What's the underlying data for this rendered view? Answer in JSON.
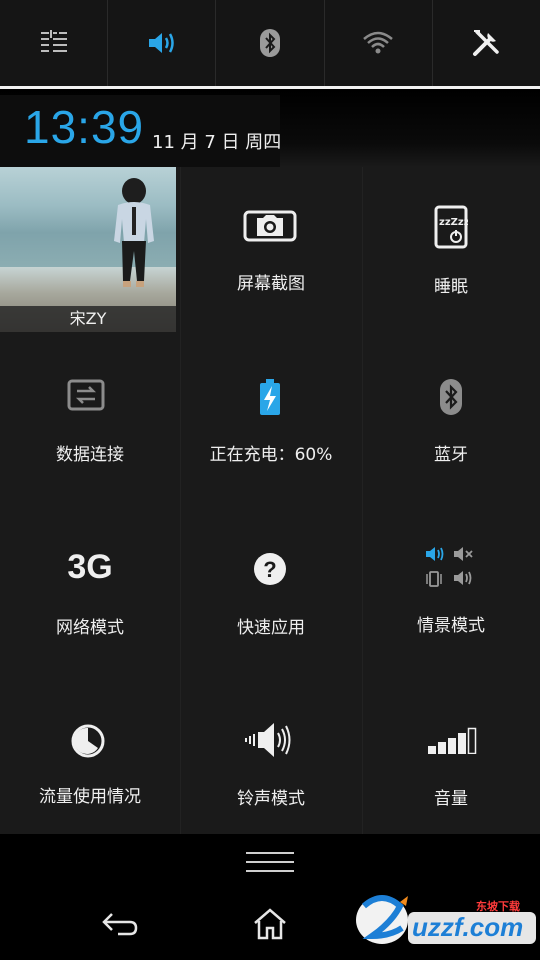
{
  "toggles": [
    {
      "name": "settings-list-icon",
      "active": false
    },
    {
      "name": "sound-icon",
      "active": true
    },
    {
      "name": "bluetooth-icon",
      "active": false
    },
    {
      "name": "wifi-icon",
      "active": false
    },
    {
      "name": "tools-icon",
      "active": false
    }
  ],
  "clock": {
    "time": "13:39",
    "date": "11 月 7 日 周四"
  },
  "profile": {
    "name": "宋ZY"
  },
  "tiles": {
    "screenshot": "屏幕截图",
    "sleep": "睡眠",
    "data": "数据连接",
    "charging": "正在充电：60%",
    "bluetooth": "蓝牙",
    "network": "网络模式",
    "network_icon_text": "3G",
    "quick_apps": "快速应用",
    "scene": "情景模式",
    "traffic": "流量使用情况",
    "ringtone": "铃声模式",
    "volume": "音量"
  },
  "watermark": {
    "text": "uzzf.com",
    "sub": "东坡下载"
  },
  "colors": {
    "accent": "#2aa6e8",
    "text": "#efefef",
    "background": "#1c1c1c"
  }
}
